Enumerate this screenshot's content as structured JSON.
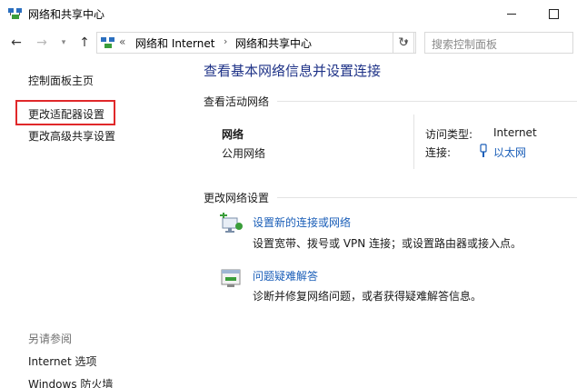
{
  "window": {
    "title": "网络和共享中心"
  },
  "address": {
    "chevron": "«",
    "segments": [
      "网络和 Internet",
      "网络和共享中心"
    ]
  },
  "search": {
    "placeholder": "搜索控制面板"
  },
  "left_pane": {
    "items": [
      "控制面板主页",
      "更改适配器设置",
      "更改高级共享设置"
    ],
    "see_also_title": "另请参阅",
    "see_also": [
      "Internet 选项",
      "Windows 防火墙"
    ]
  },
  "main": {
    "title": "查看基本网络信息并设置连接",
    "active_networks_heading": "查看活动网络",
    "network": {
      "name": "网络",
      "profile": "公用网络",
      "access_type_label": "访问类型:",
      "access_type_value": "Internet",
      "connection_label": "连接:",
      "connection_value": "以太网"
    },
    "settings_heading": "更改网络设置",
    "tasks": [
      {
        "link": "设置新的连接或网络",
        "desc": "设置宽带、拨号或 VPN 连接；或设置路由器或接入点。",
        "icon": "network-setup-icon"
      },
      {
        "link": "问题疑难解答",
        "desc": "诊断并修复网络问题，或者获得疑难解答信息。",
        "icon": "troubleshoot-icon"
      }
    ]
  },
  "colors": {
    "link": "#1a5eb8",
    "title": "#1e3287",
    "highlight": "#e0282a"
  }
}
